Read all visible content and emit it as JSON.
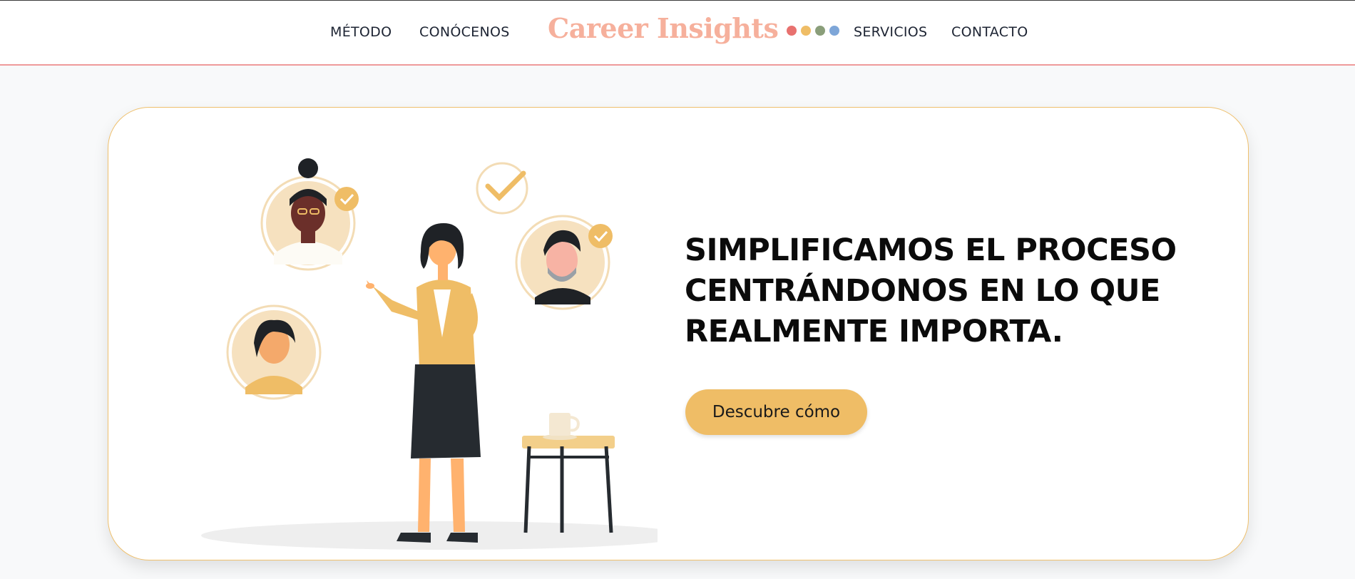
{
  "nav": {
    "left_links": [
      "MÉTODO",
      "CONÓCENOS"
    ],
    "right_links": [
      "SERVICIOS",
      "CONTACTO"
    ],
    "brand": "Career Insights",
    "brand_color": "#f6b09c",
    "brand_dots": [
      "#e8716f",
      "#efbd66",
      "#8a9e7a",
      "#7ea6d8"
    ],
    "border_color": "#ef9a9a"
  },
  "hero": {
    "headline_lines": [
      "SIMPLIFICAMOS EL PROCESO",
      "CENTRÁNDONOS EN LO QUE",
      "REALMENTE IMPORTA."
    ],
    "cta_label": "Descubre cómo",
    "accent": "#efbd66",
    "illustration": "woman-presenting-with-profile-avatars-illustration"
  }
}
